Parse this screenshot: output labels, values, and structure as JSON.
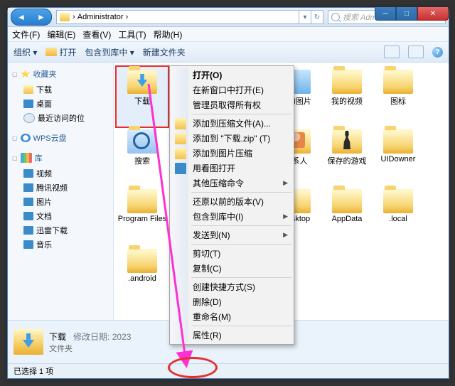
{
  "window": {
    "address": "Administrator ›",
    "search_placeholder": "搜索 Administrator",
    "win_min": "─",
    "win_max": "□",
    "win_close": "✕"
  },
  "menu": [
    "文件(F)",
    "编辑(E)",
    "查看(V)",
    "工具(T)",
    "帮助(H)"
  ],
  "toolbar": {
    "organize": "组织 ▾",
    "open": "打开",
    "include": "包含到库中 ▾",
    "new_folder": "新建文件夹",
    "help": "?"
  },
  "sidebar": {
    "fav_title": "收藏夹",
    "fav_items": [
      "下载",
      "桌面",
      "最近访问的位"
    ],
    "wps_title": "WPS云盘",
    "lib_title": "库",
    "lib_items": [
      "视频",
      "腾讯视频",
      "图片",
      "文档",
      "迅雷下载",
      "音乐"
    ]
  },
  "icons": {
    "r1": [
      "下载",
      "",
      "",
      "我的图片",
      "我的视频",
      "图标"
    ],
    "r2": [
      "搜索",
      "",
      "",
      "联系人",
      "保存的游戏",
      "UIDowner"
    ],
    "r3": [
      "Program Files",
      "",
      "",
      "Desktop",
      "AppData",
      ".local"
    ],
    "r4": [
      ".android",
      "",
      "",
      "",
      "",
      ""
    ]
  },
  "context_menu": {
    "open": "打开(O)",
    "open_new": "在新窗口中打开(E)",
    "admin_own": "管理员取得所有权",
    "add_zip_a": "添加到压缩文件(A)...",
    "add_zip_t": "添加到 \"下载.zip\" (T)",
    "add_img_zip": "添加到图片压缩",
    "open_img": "用看图打开",
    "other_zip": "其他压缩命令",
    "restore": "还原以前的版本(V)",
    "include_lib": "包含到库中(I)",
    "send_to": "发送到(N)",
    "cut": "剪切(T)",
    "copy": "复制(C)",
    "shortcut": "创建快捷方式(S)",
    "delete": "删除(D)",
    "rename": "重命名(M)",
    "properties": "属性(R)"
  },
  "details": {
    "name": "下载",
    "modified_label": "修改日期:",
    "modified_value": "2023",
    "type": "文件夹"
  },
  "status": "已选择 1 项"
}
